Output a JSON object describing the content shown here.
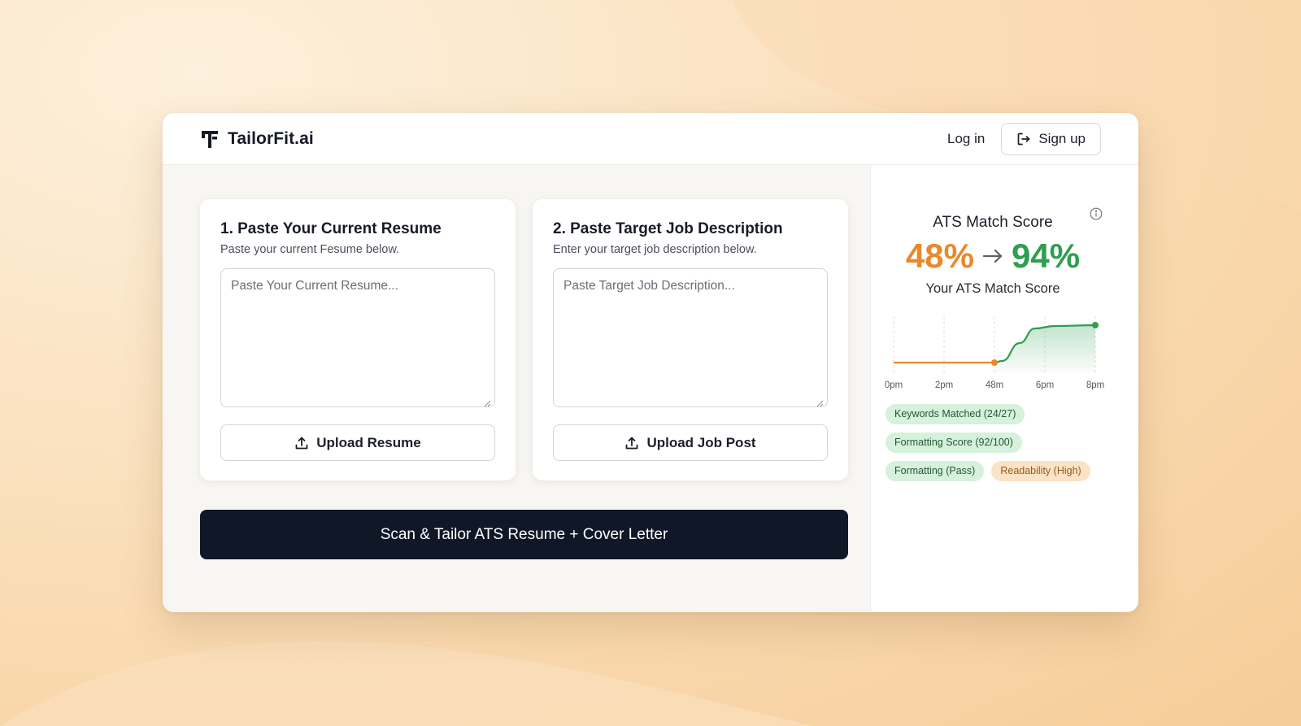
{
  "brand": {
    "name": "TailorFit.ai"
  },
  "nav": {
    "login_label": "Log in",
    "signup_label": "Sign up"
  },
  "resume_card": {
    "title": "1. Paste Your Current Resume",
    "subtitle": "Paste your current Fesume below.",
    "placeholder": "Paste Your Current Resume...",
    "upload_label": "Upload Resume"
  },
  "job_card": {
    "title": "2. Paste Target Job Description",
    "subtitle": "Enter your target job description below.",
    "placeholder": "Paste Target Job Description...",
    "upload_label": "Upload Job Post"
  },
  "scan_button_label": "Scan & Tailor ATS Resume + Cover Letter",
  "ats": {
    "title": "ATS Match Score",
    "score_before": "48%",
    "score_after": "94%",
    "caption": "Your ATS Match Score",
    "chart": {
      "type": "line",
      "x_ticks": [
        "0pm",
        "2pm",
        "48m",
        "6pm",
        "8pm"
      ],
      "points": [
        {
          "x": 0,
          "y": 48
        },
        {
          "x": 1,
          "y": 48
        },
        {
          "x": 2,
          "y": 48
        },
        {
          "x": 2.15,
          "y": 50
        },
        {
          "x": 2.5,
          "y": 72
        },
        {
          "x": 2.8,
          "y": 90
        },
        {
          "x": 3.2,
          "y": 93
        },
        {
          "x": 4,
          "y": 94
        }
      ],
      "ylim": [
        35,
        105
      ],
      "before_color": "#e8892c",
      "after_color": "#2e9e4f"
    },
    "badges": [
      [
        {
          "label": "Keywords Matched (24/27)",
          "tone": "green"
        }
      ],
      [
        {
          "label": "Formatting Score (92/100)",
          "tone": "green"
        }
      ],
      [
        {
          "label": "Formatting (Pass)",
          "tone": "green"
        },
        {
          "label": "Readability (High)",
          "tone": "orange"
        }
      ]
    ]
  },
  "colors": {
    "primary_dark": "#101828",
    "score_orange": "#e8892c",
    "score_green": "#2e9e4f"
  },
  "icons": {
    "logo": "tailorfit-logo-icon",
    "signup": "sign-in-arrow-icon",
    "upload": "upload-icon",
    "info": "info-icon",
    "arrow": "arrow-right-icon"
  }
}
